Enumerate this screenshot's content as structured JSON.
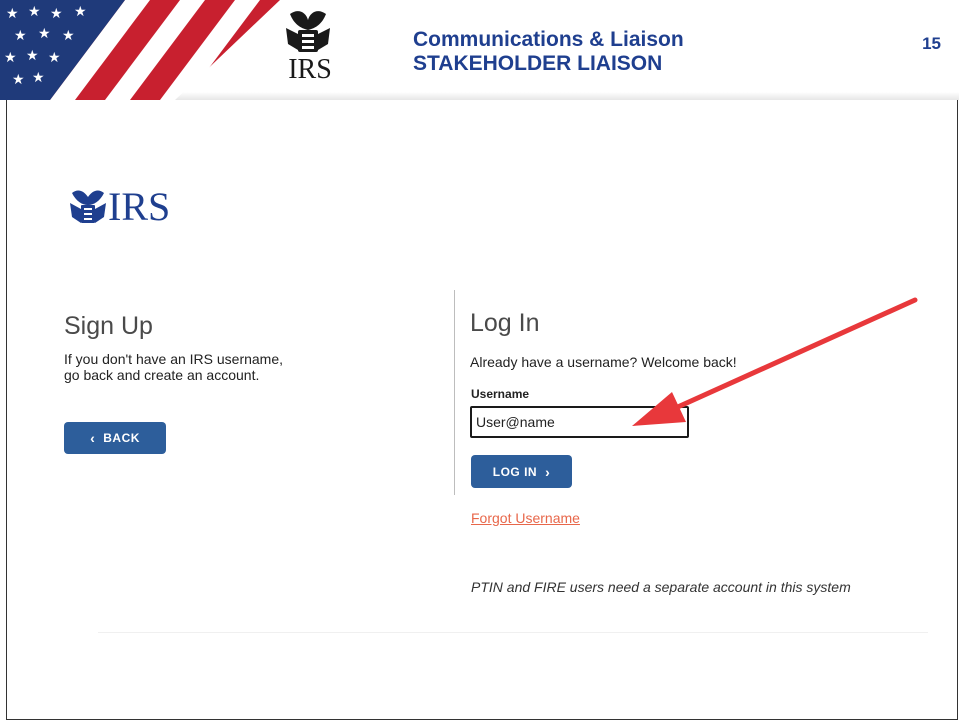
{
  "header": {
    "title_line1": "Communications & Liaison",
    "title_line2": "STAKEHOLDER LIAISON",
    "page_number": "15",
    "logo_text": "IRS"
  },
  "brand": {
    "logo_text": "IRS"
  },
  "signup": {
    "title": "Sign Up",
    "description_line1": "If you don't have an IRS username,",
    "description_line2": "go back and create an account.",
    "back_label": "BACK",
    "back_icon": "chevron-left-icon"
  },
  "login": {
    "title": "Log In",
    "description": "Already have a username? Welcome back!",
    "username_label": "Username",
    "username_value": "User@name",
    "login_label": "LOG IN",
    "login_icon": "chevron-right-icon",
    "forgot_label": "Forgot Username",
    "note": "PTIN and FIRE users need a separate account in this system"
  },
  "colors": {
    "header_text": "#1f3f8f",
    "button": "#2d5e9b",
    "link": "#e8674a",
    "annotation_arrow": "#e8383b"
  }
}
